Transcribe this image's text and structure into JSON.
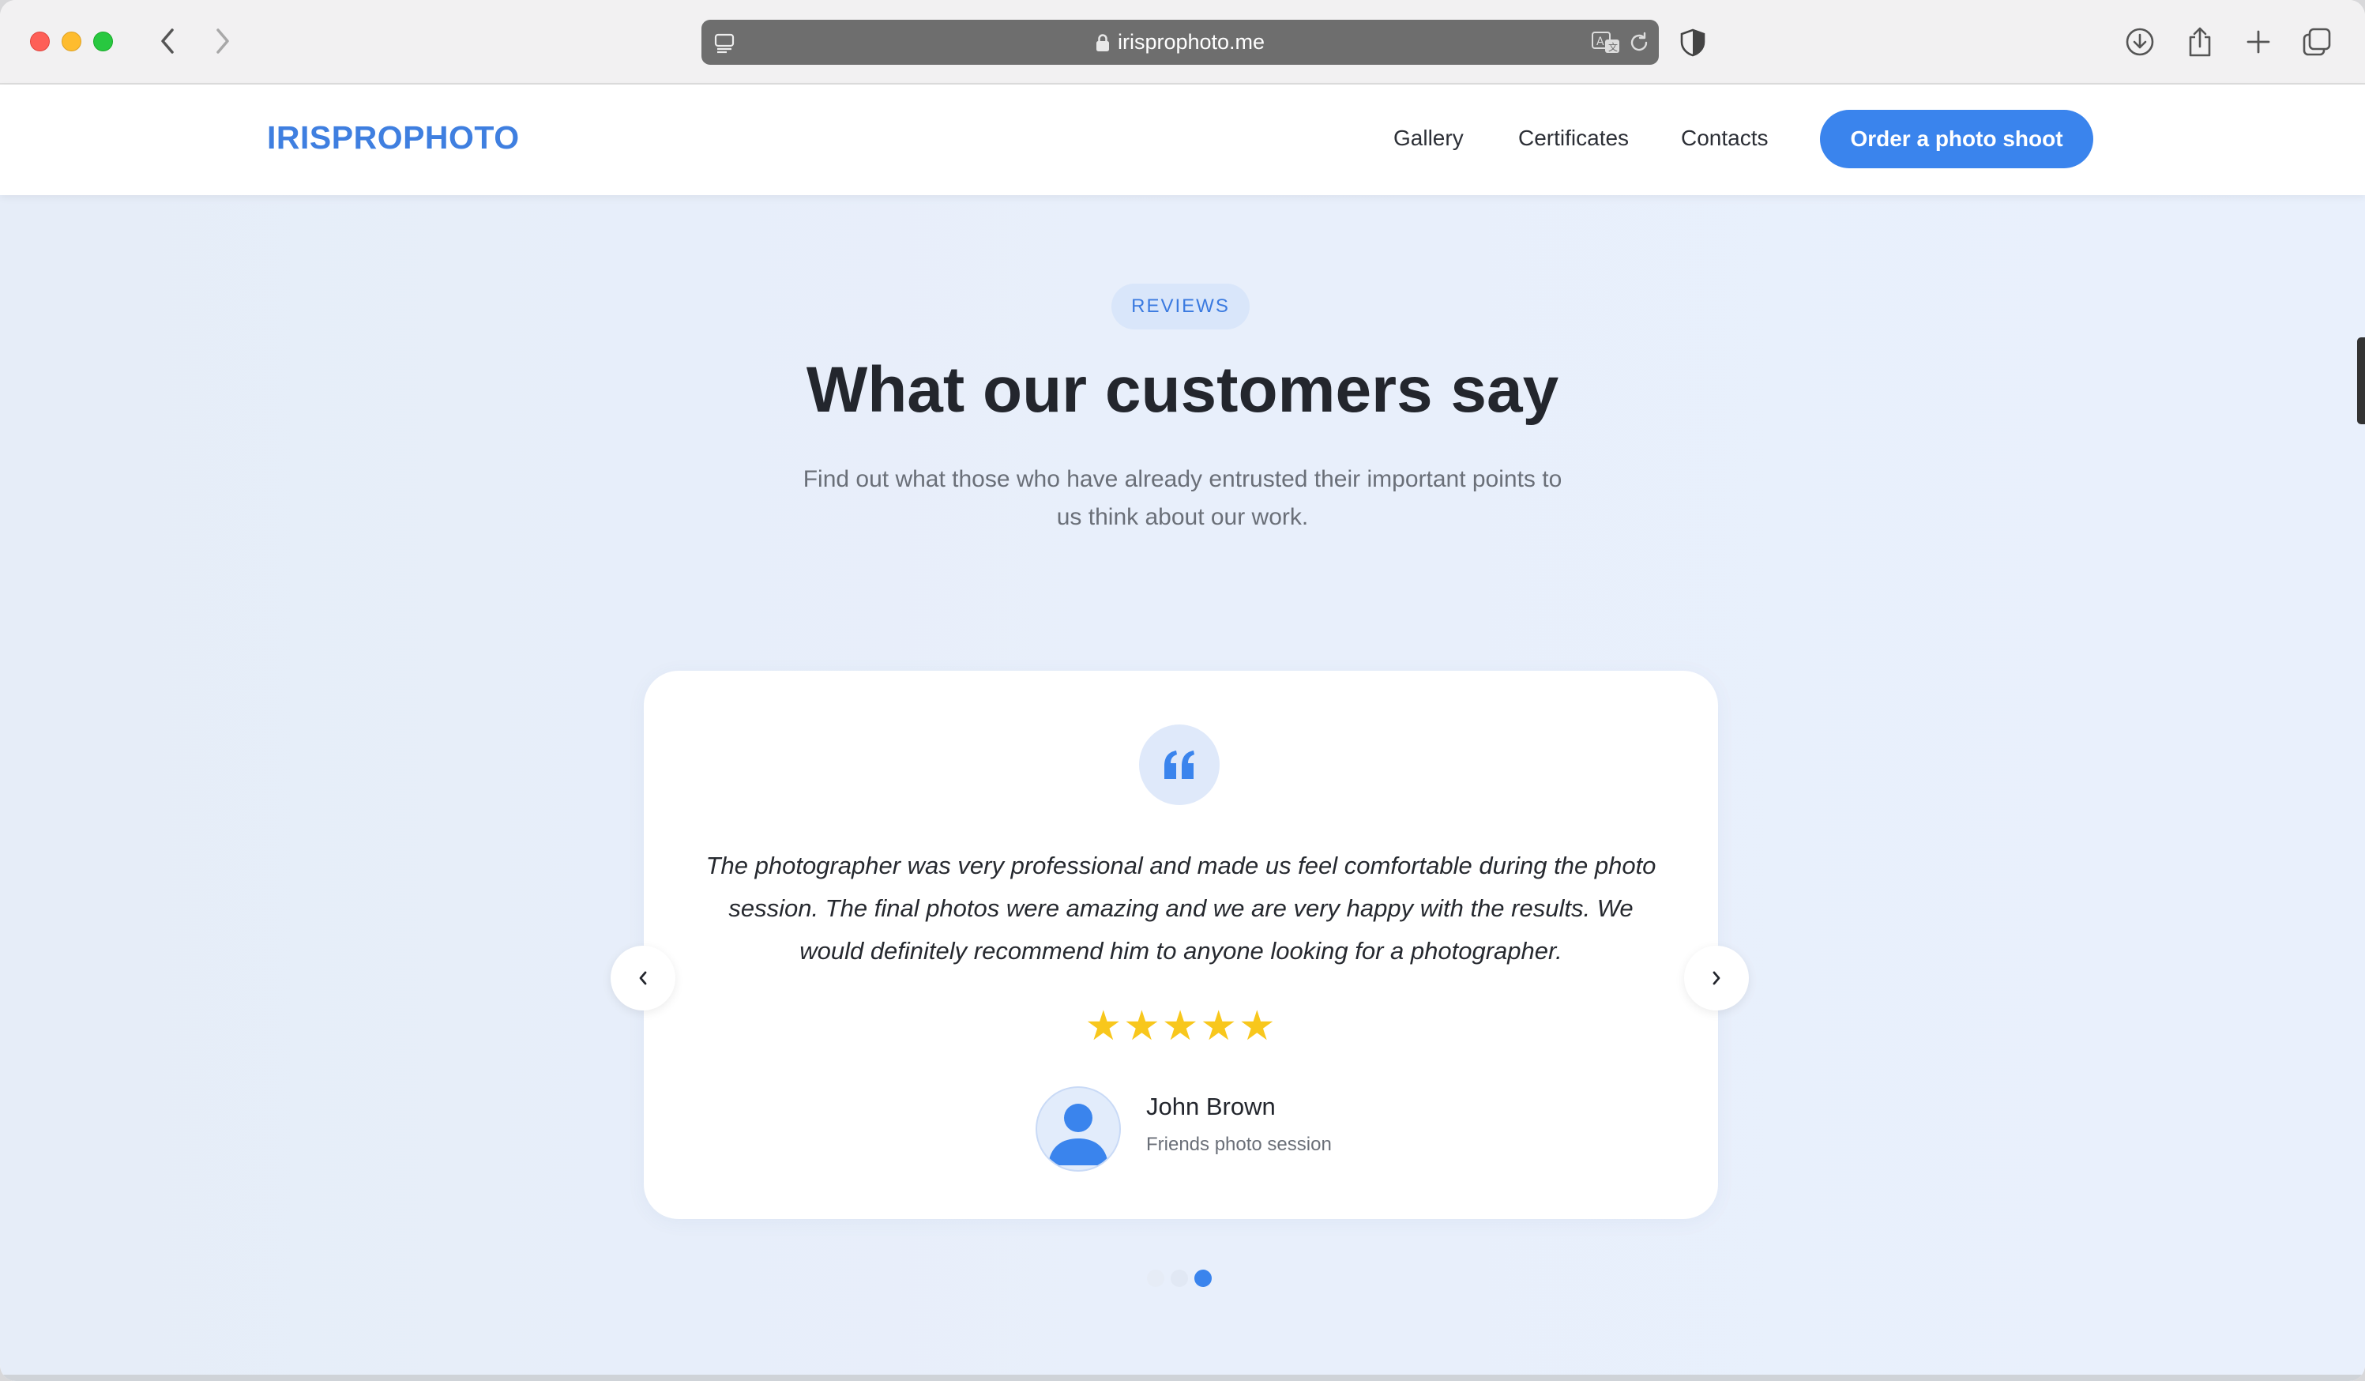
{
  "browser": {
    "url": "irisprophoto.me",
    "icons": {
      "back": "chevron-left-icon",
      "forward": "chevron-right-icon",
      "reader": "reader-icon",
      "lock": "lock-icon",
      "translate": "translate-icon",
      "reload": "reload-icon",
      "shield": "shield-icon",
      "download": "download-icon",
      "share": "share-icon",
      "new_tab": "plus-icon",
      "tabs": "tab-overview-icon"
    }
  },
  "header": {
    "logo": "IRISPROPHOTO",
    "nav": [
      "Gallery",
      "Certificates",
      "Contacts"
    ],
    "cta": "Order a photo shoot"
  },
  "section": {
    "badge": "REVIEWS",
    "title": "What our customers say",
    "subtitle_line1": "Find out what those who have already entrusted their important points to",
    "subtitle_line2": "us think about our work."
  },
  "review": {
    "quote_icon": "quote-icon",
    "text_line1": "The photographer was very professional and made us feel comfortable during the photo",
    "text_line2": "session. The final photos were amazing and we are very happy with the results. We",
    "text_line3": "would definitely recommend him to anyone looking for a photographer.",
    "rating": 5,
    "rating_max": 5,
    "reviewer_name": "John Brown",
    "reviewer_session": "Friends photo session"
  },
  "carousel": {
    "slide_count": 3,
    "active_index": 2,
    "prev_icon": "chevron-left-icon",
    "next_icon": "chevron-right-icon"
  },
  "colors": {
    "accent": "#3a84ed",
    "logo": "#3f7fe0",
    "star": "#f8c71c",
    "background": "#e8effb"
  }
}
